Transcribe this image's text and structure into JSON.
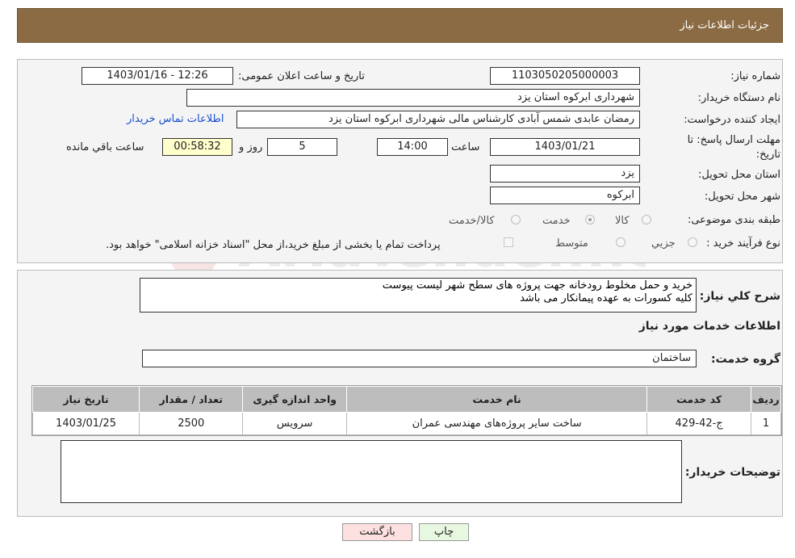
{
  "header": {
    "title": "جزئیات اطلاعات نیاز"
  },
  "form": {
    "need_number_label": "شماره نیاز:",
    "need_number": "1103050205000003",
    "announce_label": "تاریخ و ساعت اعلان عمومی:",
    "announce_value": "1403/01/16 - 12:26",
    "buyer_org_label": "نام دستگاه خریدار:",
    "buyer_org": "شهرداری ابرکوه استان یزد",
    "creator_label": "ایجاد کننده درخواست:",
    "creator": "رمضان عابدی شمس آبادی کارشناس مالی شهرداری ابرکوه استان یزد",
    "contact_link": "اطلاعات تماس خریدار",
    "deadline_label": "مهلت ارسال پاسخ: تا تاریخ:",
    "deadline_date": "1403/01/21",
    "time_label": "ساعت",
    "deadline_time": "14:00",
    "days": "5",
    "days_label": "روز و",
    "remaining": "00:58:32",
    "remaining_label": "ساعت باقي مانده",
    "province_label": "استان محل تحویل:",
    "province": "یزد",
    "city_label": "شهر محل تحویل:",
    "city": "ابرکوه",
    "category_label": "طبقه بندی موضوعی:",
    "category_options": [
      "کالا",
      "خدمت",
      "کالا/خدمت"
    ],
    "process_label": "نوع فرآیند خرید :",
    "process_options": [
      "جزیي",
      "متوسط"
    ],
    "payment_note": "پرداخت تمام یا بخشی از مبلغ خرید،از محل \"اسناد خزانه اسلامی\" خواهد بود."
  },
  "description": {
    "label": "شرح كلي نياز:",
    "text": "خرید و حمل مخلوط رودخانه جهت پروژه های سطح شهر لیست پیوست\nکلیه کسورات به عهده پیمانکار می باشد"
  },
  "services": {
    "section_title": "اطلاعات خدمات مورد نياز",
    "group_label": "گروه خدمت:",
    "group_value": "ساختمان",
    "columns": [
      "رديف",
      "كد خدمت",
      "نام خدمت",
      "واحد اندازه گيری",
      "تعداد / مقدار",
      "تاريخ نياز"
    ],
    "rows": [
      [
        "1",
        "ج-42-429",
        "ساخت سایر پروژه‌های مهندسی عمران",
        "سرويس",
        "2500",
        "1403/01/25"
      ]
    ]
  },
  "buyer_notes": {
    "label": "توضيحات خريدار:",
    "text": ""
  },
  "buttons": {
    "print": "چاپ",
    "back": "بازگشت"
  },
  "watermark": {
    "text": "AriaTender.neT"
  },
  "colors": {
    "header_bg": "#8b6b44",
    "link": "#1a4fd0",
    "table_header": "#bdbdbd",
    "back_button": "#fde0e0",
    "print_button": "#e8f7e0"
  }
}
